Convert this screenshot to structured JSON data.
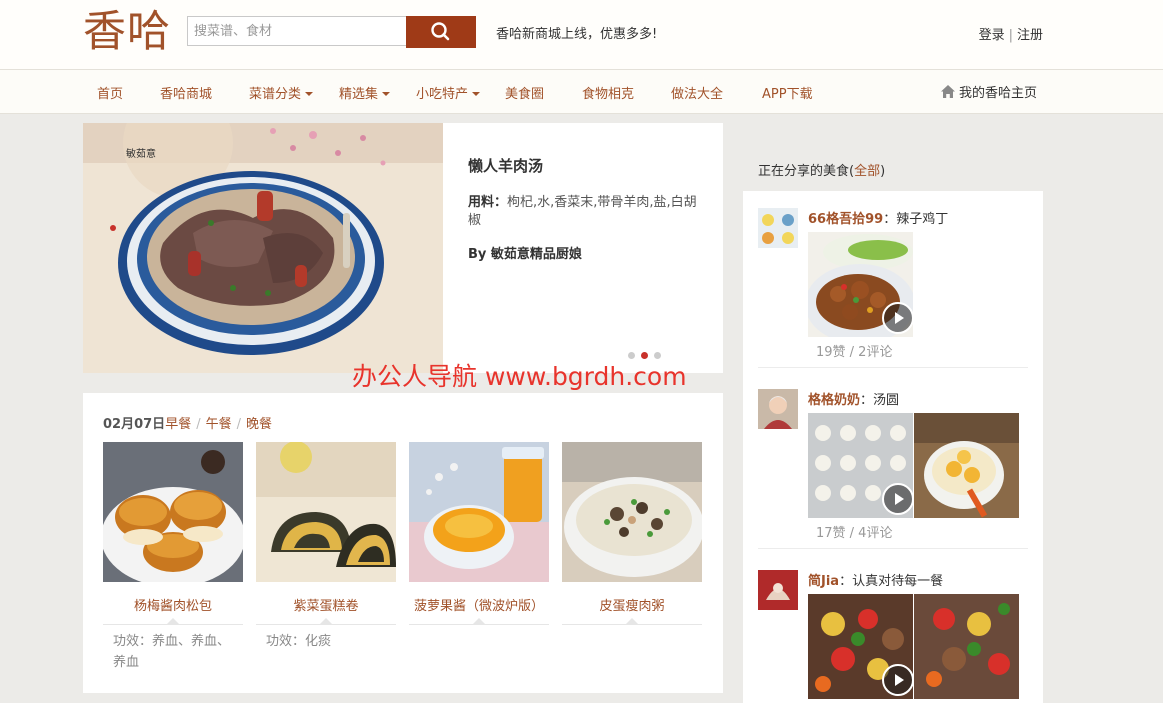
{
  "header": {
    "logo": "香哈",
    "search_placeholder": "搜菜谱、食材",
    "announcement": "香哈新商城上线，优惠多多!",
    "login": "登录",
    "divider": "|",
    "register": "注册"
  },
  "nav": {
    "items": [
      "首页",
      "香哈商城",
      "菜谱分类",
      "精选集",
      "小吃特产",
      "美食圈",
      "食物相克",
      "做法大全",
      "APP下载"
    ],
    "home": "我的香哈主页"
  },
  "hero": {
    "image_caption": "敏茹意",
    "title": "懒人羊肉汤",
    "ingredients_label": "用料：",
    "ingredients": "枸杞,水,香菜末,带骨羊肉,盐,白胡椒",
    "author": "By 敏茹意精品厨娘",
    "slide_count": 3,
    "active_slide": 2
  },
  "watermark": "办公人导航  www.bgrdh.com",
  "daily": {
    "date": "02月07日",
    "tabs": [
      "早餐",
      "午餐",
      "晚餐"
    ],
    "cards": [
      {
        "name": "杨梅酱肉松包",
        "effect": "功效：养血、养血、养血"
      },
      {
        "name": "紫菜蛋糕卷",
        "effect": "功效：化痰"
      },
      {
        "name": "菠萝果酱（微波炉版）",
        "effect": ""
      },
      {
        "name": "皮蛋瘦肉粥",
        "effect": ""
      }
    ]
  },
  "sidebar": {
    "title": "正在分享的美食(",
    "all": "全部",
    "title_end": ")",
    "shares": [
      {
        "user": "66格吾拾99",
        "colon": "：",
        "dish": "辣子鸡丁",
        "stats": "19赞 / 2评论"
      },
      {
        "user": "格格奶奶",
        "colon": "：",
        "dish": "汤圆",
        "stats": "17赞 / 4评论"
      },
      {
        "user": "简Jia",
        "colon": "：",
        "dish": "认真对待每一餐",
        "stats": ""
      }
    ]
  }
}
